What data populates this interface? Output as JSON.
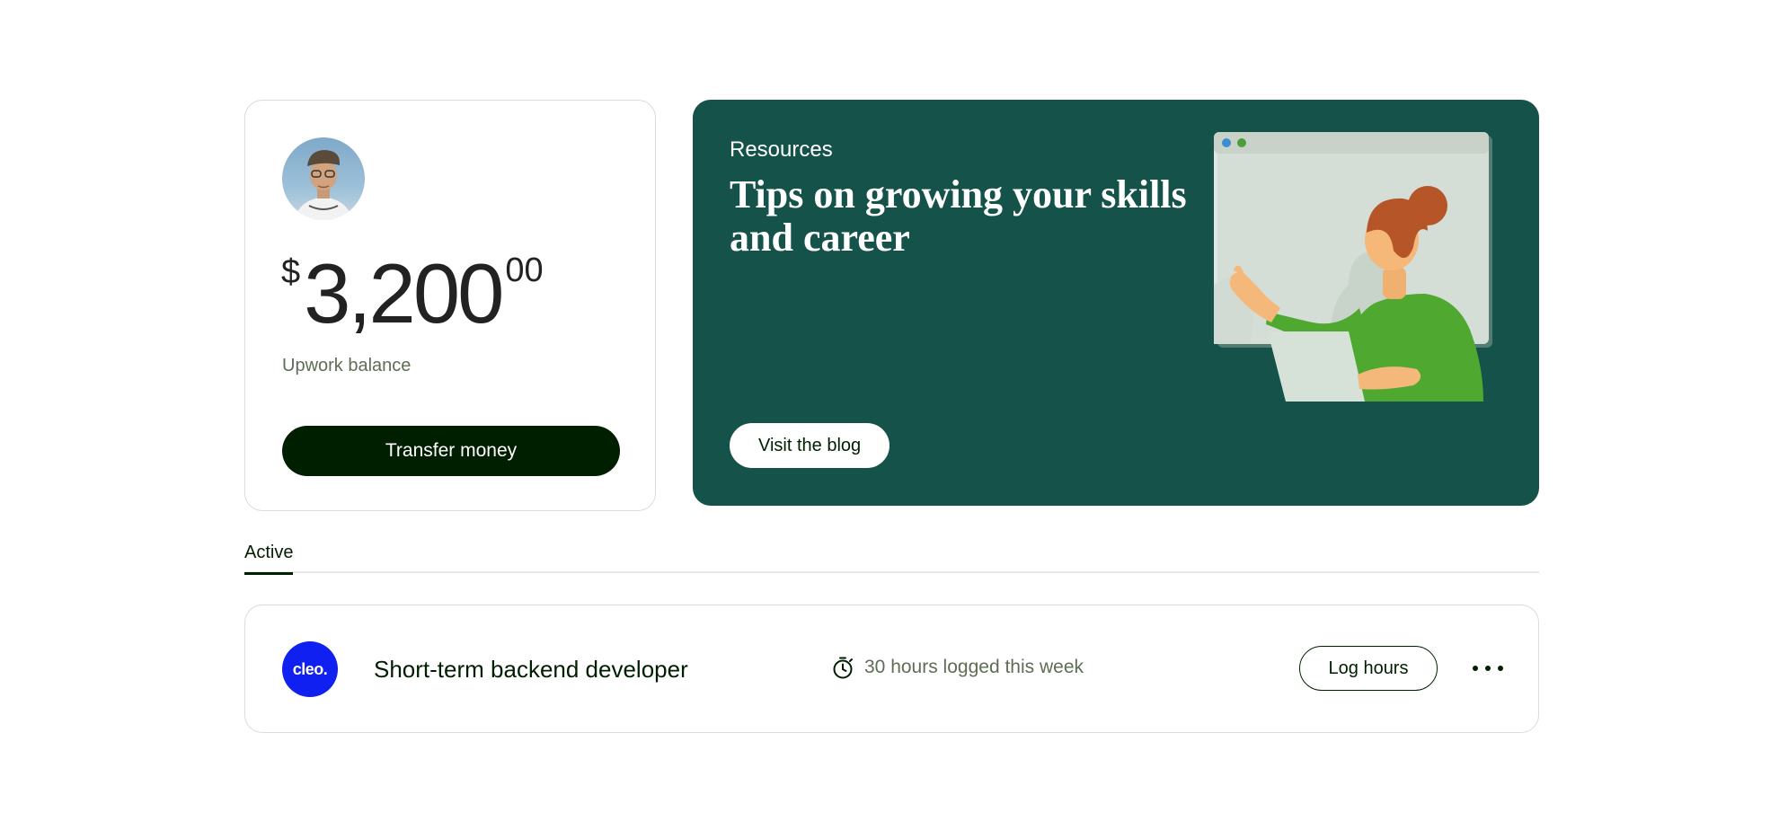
{
  "balance": {
    "currency_symbol": "$",
    "amount_whole": "3,200",
    "amount_cents": "00",
    "label": "Upwork balance",
    "transfer_label": "Transfer money"
  },
  "resources": {
    "eyebrow": "Resources",
    "title": "Tips on growing your skills and career",
    "button_label": "Visit the blog",
    "background_color": "#155249"
  },
  "tabs": [
    {
      "label": "Active",
      "selected": true
    }
  ],
  "contract": {
    "client_logo_text": "cleo.",
    "client_logo_color": "#1020f0",
    "title": "Short-term backend developer",
    "hours_icon": "stopwatch-icon",
    "hours_text": "30 hours logged this week",
    "log_hours_label": "Log hours",
    "more_icon": "more-horizontal-icon"
  }
}
